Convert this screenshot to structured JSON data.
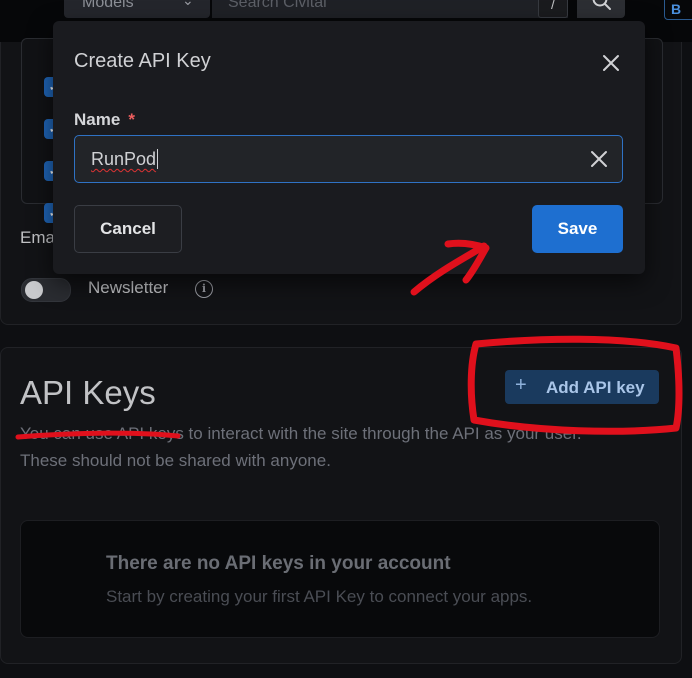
{
  "header": {
    "models_label": "Models",
    "search_placeholder": "Search Civitai",
    "search_shortcut": "/"
  },
  "settings": {
    "email_label": "Ema",
    "newsletter_label": "Newsletter"
  },
  "api_keys": {
    "title": "API Keys",
    "description": "You can use API keys to interact with the site through the API as your user.\nThese should not be shared with anyone.",
    "add_button_label": "Add API key",
    "empty_title": "There are no API keys in your account",
    "empty_subtitle": "Start by creating your first API Key to connect your apps."
  },
  "modal": {
    "title": "Create API Key",
    "name_label": "Name",
    "required_marker": "*",
    "name_value": "RunPod",
    "cancel_label": "Cancel",
    "save_label": "Save"
  },
  "colors": {
    "primary": "#1e6fd0",
    "annotation_red": "#e0101c",
    "background": "#0e0f12"
  },
  "icons": [
    "chevron-down-icon",
    "search-icon",
    "close-icon",
    "clear-icon",
    "info-icon",
    "plus-icon",
    "check-icon"
  ]
}
